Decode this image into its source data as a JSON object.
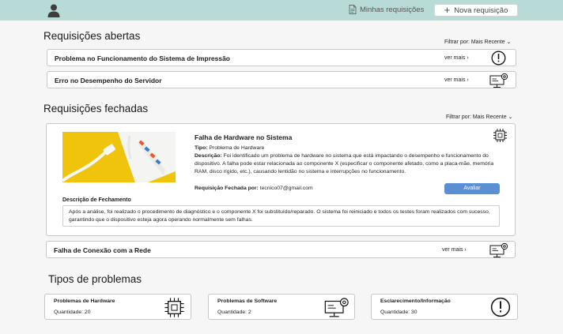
{
  "header": {
    "my_requests_label": "Minhas requisições",
    "new_request_label": "Nova requisição"
  },
  "open_section": {
    "title": "Requisições abertas",
    "filter_label": "Filtrar por: Mais Recente",
    "items": [
      {
        "title": "Problema no Funcionamento do Sistema de Impressão",
        "more": "ver mais ›",
        "icon": "exclamation-icon"
      },
      {
        "title": "Erro no Desempenho do Servidor",
        "more": "ver mais ›",
        "icon": "monitor-gear-icon"
      }
    ]
  },
  "closed_section": {
    "title": "Requisições fechadas",
    "filter_label": "Filtrar por: Mais Recente",
    "expanded": {
      "title": "Falha de Hardware no Sistema",
      "type_label": "Tipo:",
      "type_value": "Problema de Hardware",
      "desc_label": "Descrição:",
      "desc_value": "Foi identificado um problema de hardware no sistema que está impactando o desempenho e funcionamento do dispositivo. A falha pode estar relacionada ao componente X (especificar o componente afetado, como a placa-mãe, memória RAM, disco rígido, etc.), causando lentidão no sistema e interrupções no funcionamento.",
      "closed_by_label": "Requisição Fechada por:",
      "closed_by_value": "tecnico07@gmail.com",
      "rate_button": "Avaliar",
      "closing_label": "Descrição de Fechamento",
      "closing_text": "Após a análise, foi realizado o procedimento de diagnóstico e o componente X foi substituído/reparado. O sistema foi reiniciado e todos os testes foram realizados com sucesso, garantindo que o dispositivo esteja agora operando normalmente sem falhas.",
      "icon": "chip-icon"
    },
    "items": [
      {
        "title": "Falha de Conexão com a Rede",
        "more": "ver mais ›",
        "icon": "monitor-gear-icon"
      }
    ]
  },
  "types_section": {
    "title": "Tipos de problemas",
    "cards": [
      {
        "name": "Problemas de Hardware",
        "qty": "Quantidade: 20",
        "icon": "chip-icon"
      },
      {
        "name": "Problemas de Software",
        "qty": "Quantidade: 2",
        "icon": "monitor-gear-icon"
      },
      {
        "name": "Esclarecimento/Informação",
        "qty": "Quantidade: 30",
        "icon": "exclamation-icon"
      }
    ]
  }
}
